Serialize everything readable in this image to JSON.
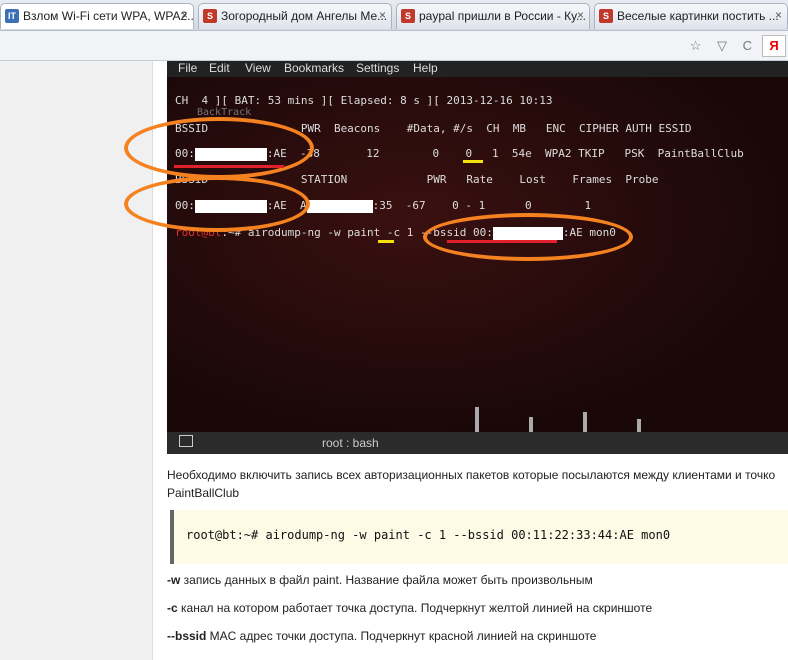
{
  "tabs": [
    {
      "label": "Взлом Wi-Fi сети WPA, WPA2...",
      "favicon": "IT",
      "color": "#3b6fb6",
      "close": "×"
    },
    {
      "label": "Зогородный дом Ангелы Ме...",
      "favicon": "S",
      "color": "#c0392b",
      "close": "×"
    },
    {
      "label": "paypal пришли в России - Ку...",
      "favicon": "S",
      "color": "#c0392b",
      "close": "×"
    },
    {
      "label": "Веселые картинки постить ...",
      "favicon": "S",
      "color": "#c0392b",
      "close": "×"
    }
  ],
  "toolbar": {
    "icons": "☆ ▽ C",
    "yandex": "Я"
  },
  "terminal": {
    "menu": [
      "File",
      "Edit",
      "View",
      "Bookmarks",
      "Settings",
      "Help"
    ],
    "line1": "CH  4 ][ BAT: 53 mins ][ Elapsed: 8 s ][ 2013-12-16 10:13",
    "watermark": "BackTrack",
    "ap_header": "BSSID              PWR  Beacons    #Data, #/s  CH  MB   ENC  CIPHER AUTH ESSID",
    "ap_row_prefix": "00:",
    "ap_row_suffix": ":AE  -38       12        0    0   1  54e  WPA2 TKIP   PSK  PaintBallClub",
    "st_header": "BSSID              STATION            PWR   Rate    Lost    Frames  Probe",
    "st_row_prefix": "00:",
    "st_row_mid": ":AE  A",
    "st_row_suffix": ":35  -67    0 - 1      0        1",
    "cmd_prompt": "root@bt",
    "cmd_text": ":~# airodump-ng -w paint -c 1 --bssid 00:",
    "cmd_suffix": ":AE mon0",
    "status": "root : bash"
  },
  "content": {
    "para1_line1": "Необходимо включить запись всех авторизационных пакетов которые посылаются между клиентами и точко",
    "para1_line2": "PaintBallClub",
    "code": "root@bt:~# airodump-ng -w paint -c 1 --bssid 00:11:22:33:44:AE mon0",
    "w_flag": "-w",
    "w_desc": " запись данных в файл paint. Название файла может быть произвольным",
    "c_flag": "-c",
    "c_desc": " канал на котором работает точка доступа. Подчеркнут желтой линией на скриншоте",
    "bssid_flag": "--bssid",
    "bssid_desc": " MAC адрес точки доступа. Подчеркнут красной линией на скриншоте"
  },
  "colors": {
    "orange": "#f58220",
    "red": "#e0202a",
    "yellow": "#f2e20a"
  }
}
